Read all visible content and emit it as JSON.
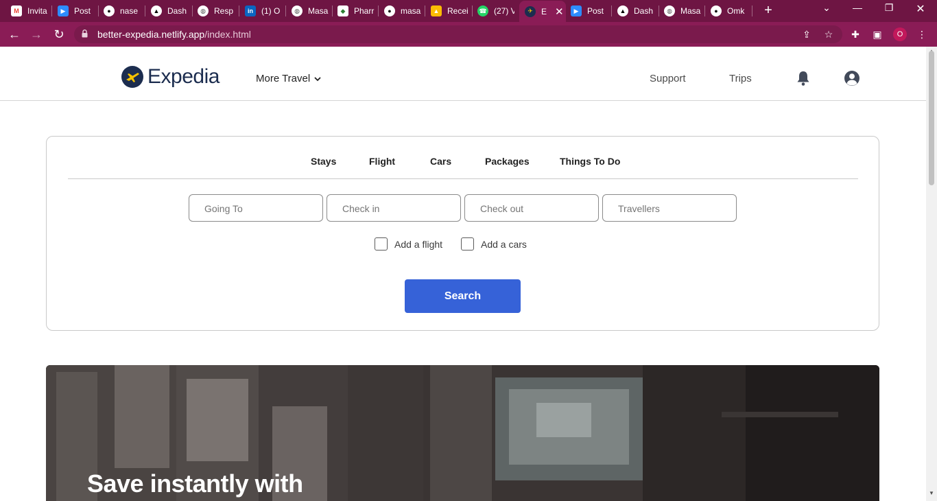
{
  "browser": {
    "tabs": [
      {
        "title": "Invita",
        "icon": "gmail-icon",
        "color": "#ea4335"
      },
      {
        "title": "Post",
        "icon": "zoom-icon",
        "color": "#2d8cff"
      },
      {
        "title": "nase",
        "icon": "github-icon",
        "color": "#111111"
      },
      {
        "title": "Dash",
        "icon": "vercel-icon",
        "color": "#000000"
      },
      {
        "title": "Resp",
        "icon": "globe-icon",
        "color": "#555555"
      },
      {
        "title": "(1) O",
        "icon": "linkedin-icon",
        "color": "#0a66c2"
      },
      {
        "title": "Masa",
        "icon": "globe-icon",
        "color": "#555555"
      },
      {
        "title": "Pharr",
        "icon": "app-icon",
        "color": "#2e7d32"
      },
      {
        "title": "masa",
        "icon": "github-icon",
        "color": "#111111"
      },
      {
        "title": "Recei",
        "icon": "drive-icon",
        "color": "#fbbc04"
      },
      {
        "title": "(27) V",
        "icon": "whatsapp-icon",
        "color": "#25d366"
      },
      {
        "title": "E",
        "icon": "expedia-icon",
        "color": "#1c2d4f"
      },
      {
        "title": "Post",
        "icon": "zoom-icon",
        "color": "#2d8cff"
      },
      {
        "title": "Dash",
        "icon": "vercel-icon",
        "color": "#000000"
      },
      {
        "title": "Masa",
        "icon": "globe-icon",
        "color": "#555555"
      },
      {
        "title": "Omk",
        "icon": "github-icon",
        "color": "#111111"
      }
    ],
    "url_domain": "better-expedia.netlify.app",
    "url_path": "/index.html",
    "profile_initial": "O"
  },
  "header": {
    "brand": "Expedia",
    "more_travel": "More Travel",
    "support": "Support",
    "trips": "Trips"
  },
  "search": {
    "tabs": [
      "Stays",
      "Flight",
      "Cars",
      "Packages",
      "Things To Do"
    ],
    "fields": {
      "going_to": "Going To",
      "check_in": "Check in",
      "check_out": "Check out",
      "travellers": "Travellers"
    },
    "add_flight": "Add a flight",
    "add_cars": "Add a cars",
    "button": "Search"
  },
  "hero": {
    "title": "Save instantly with"
  },
  "colors": {
    "accent": "#3662d8",
    "brand_navy": "#1c2d4f",
    "browser_chrome": "#8a1c56"
  }
}
